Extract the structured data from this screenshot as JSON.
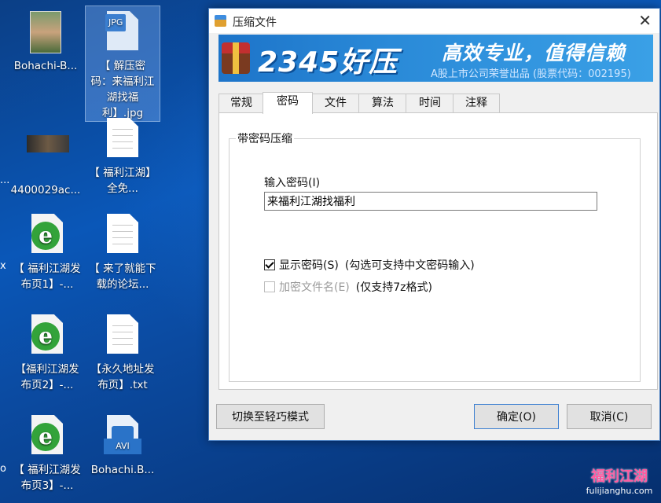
{
  "desktop": {
    "icons": [
      {
        "label": "Bohachi-B..."
      },
      {
        "label": "【 解压密码：来福利江湖找福利】.jpg",
        "badge": "JPG"
      },
      {
        "label": "4400029ac..."
      },
      {
        "label": "【 福利江湖】全免..."
      },
      {
        "label": "【 福利江湖发布页1】-..."
      },
      {
        "label": "【 来了就能下载的论坛..."
      },
      {
        "label": "【福利江湖发布页2】-..."
      },
      {
        "label": "【永久地址发布页】.txt"
      },
      {
        "label": "【 福利江湖发布页3】-..."
      },
      {
        "label": "Bohachi.B...",
        "badge": "AVI"
      }
    ],
    "edge_fragments": [
      "...",
      "x",
      "o"
    ]
  },
  "dialog": {
    "title": "压缩文件",
    "close_glyph": "✕",
    "banner": {
      "brand": "2345好压",
      "slogan": "高效专业，值得信赖",
      "sub": "A股上市公司荣誉出品 (股票代码：002195)"
    },
    "tabs": [
      "常规",
      "密码",
      "文件",
      "算法",
      "时间",
      "注释"
    ],
    "active_tab": "密码",
    "group_title": "带密码压缩",
    "password_label": "输入密码(I)",
    "password_value": "来福利江湖找福利",
    "show_password": {
      "label": "显示密码(S)",
      "hint": "(勾选可支持中文密码输入)",
      "checked": true
    },
    "encrypt_names": {
      "label": "加密文件名(E)",
      "hint": "(仅支持7z格式)",
      "checked": false,
      "disabled": true
    },
    "buttons": {
      "switch_mode": "切换至轻巧模式",
      "ok": "确定(O)",
      "cancel": "取消(C)"
    }
  },
  "watermark": {
    "top": "福利江湖",
    "bottom": "fulijianghu.com"
  }
}
